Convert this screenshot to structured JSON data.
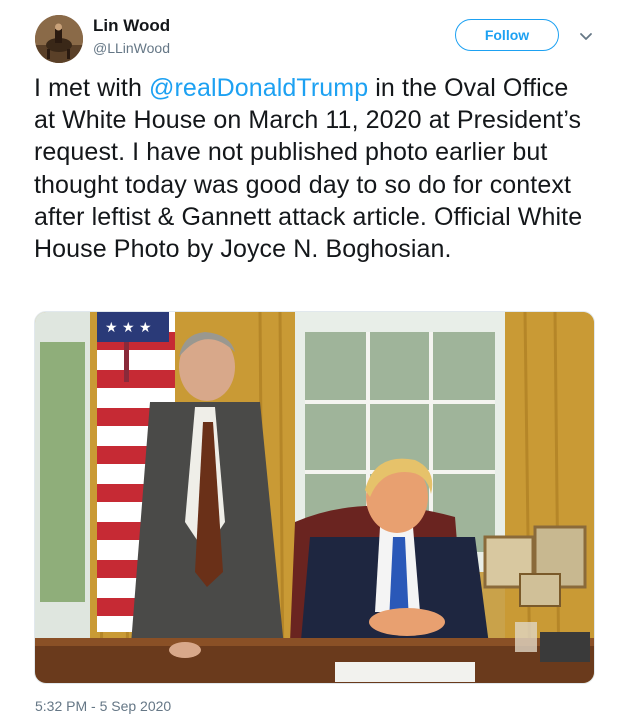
{
  "author": {
    "name": "Lin Wood",
    "handle": "@LLinWood"
  },
  "actions": {
    "follow_label": "Follow",
    "menu_icon": "chevron-down-icon"
  },
  "tweet": {
    "text_before": "I met with ",
    "mention": "@realDonaldTrump",
    "text_after": " in the Oval Office at White House on March 11, 2020 at President’s request. I have not published photo earlier but thought today was good day to so do for context after leftist & Gannett attack article. Official White House Photo by Joyce N. Boghosian.",
    "timestamp": "5:32 PM - 5 Sep 2020"
  },
  "colors": {
    "accent": "#1da1f2",
    "text": "#14171a",
    "muted": "#657786"
  }
}
